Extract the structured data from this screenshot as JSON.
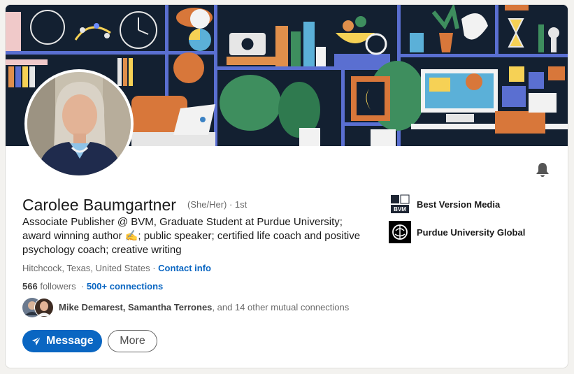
{
  "profile": {
    "name": "Carolee Baumgartner",
    "pronouns": "(She/Her) · 1st",
    "headline": "Associate Publisher @ BVM, Graduate Student at Purdue University; award winning author ✍️; public speaker; certified life coach and positive psychology coach; creative writing",
    "location": "Hitchcock, Texas, United States",
    "location_separator": "·",
    "contact_info": "Contact info",
    "followers_count": "566",
    "followers_label": "followers",
    "connections_separator": "·",
    "connections": "500+ connections"
  },
  "mutual": {
    "names": "Mike Demarest, Samantha Terrones",
    "rest": ", and 14 other mutual connections"
  },
  "actions": {
    "message_label": "Message",
    "more_label": "More"
  },
  "experience": [
    {
      "label": "Best Version Media",
      "logo_text": "BVM",
      "logo_icon": "bvm-logo"
    },
    {
      "label": "Purdue University Global",
      "logo_icon": "purdue-global-logo"
    }
  ],
  "icons": {
    "notify": "bell-icon",
    "message": "paper-plane-icon"
  },
  "colors": {
    "accent": "#0a66c2",
    "banner_bg": "#132031"
  }
}
